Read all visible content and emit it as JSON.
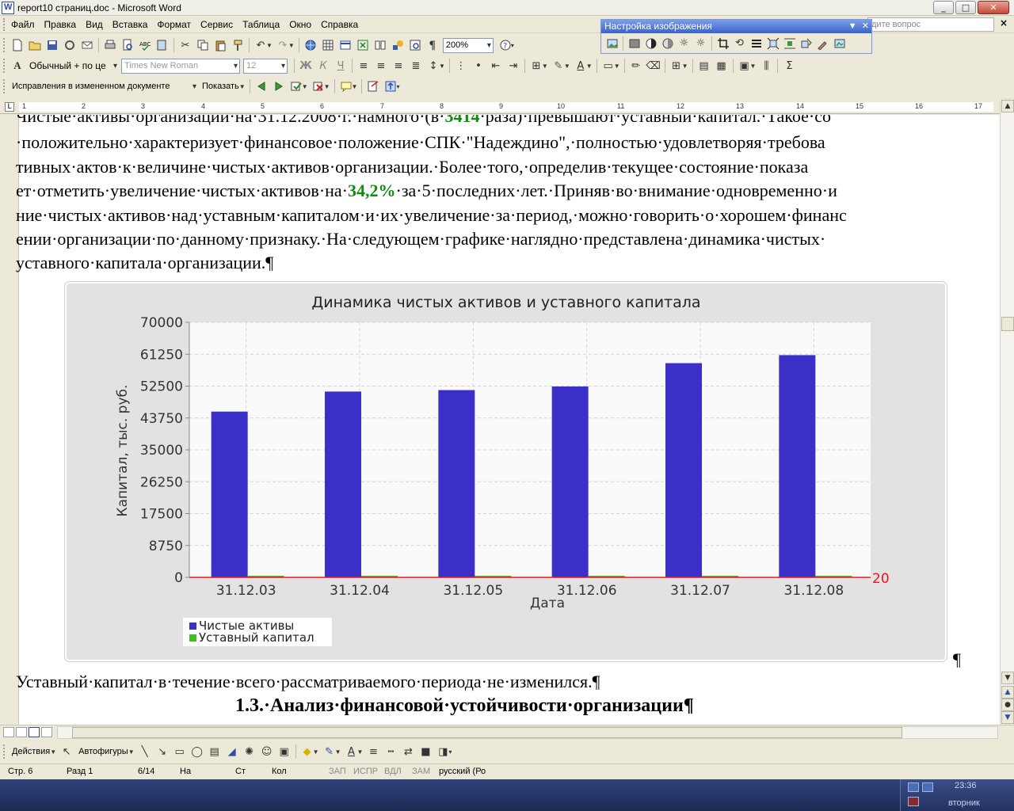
{
  "window": {
    "title": "report10 страниц.doc - Microsoft Word"
  },
  "menu": {
    "items": [
      "Файл",
      "Правка",
      "Вид",
      "Вставка",
      "Формат",
      "Сервис",
      "Таблица",
      "Окно",
      "Справка"
    ],
    "help_placeholder": "дите вопрос",
    "close_glyph": "×"
  },
  "picture_toolbar": {
    "title": "Настройка изображения"
  },
  "standard_toolbar": {
    "zoom": "200%"
  },
  "format_toolbar": {
    "style": "Обычный + по це",
    "font": "Times New Roman",
    "size": "12"
  },
  "review_toolbar": {
    "display_mode": "Исправления в измененном документе",
    "show_label": "Показать"
  },
  "ruler": {
    "corner": "L",
    "numbers": [
      "1",
      "1",
      "2",
      "3",
      "4",
      "5",
      "6",
      "7",
      "8",
      "9",
      "10",
      "11",
      "12",
      "13",
      "14",
      "15",
      "16",
      "17"
    ]
  },
  "document": {
    "lines": [
      {
        "pre": "Чистые·активы·организации·на·31.12.2008·г.·намного·(в·",
        "hl": "3414",
        "post": "·раза)·превышают·уставный·капитал.·Такое·со"
      },
      {
        "pre": "·положительно·характеризует·финансовое·положение·СПК·\"Надеждино\",·полностью·удовлетворяя·требова",
        "hl": "",
        "post": ""
      },
      {
        "pre": "тивных·актов·к·величине·чистых·активов·организации.·Более·того,·определив·текущее·состояние·показа",
        "hl": "",
        "post": ""
      },
      {
        "pre": "ет·отметить·увеличение·чистых·активов·на·",
        "hl": "34,2%",
        "post": "·за·5·последних·лет.·Приняв·во·внимание·одновременно·и"
      },
      {
        "pre": "ние·чистых·активов·над·уставным·капиталом·и·их·увеличение·за·период,·можно·говорить·о·хорошем·финанс",
        "hl": "",
        "post": ""
      },
      {
        "pre": "ении·организации·по·данному·признаку.·На·следующем·графике·наглядно·представлена·динамика·чистых·",
        "hl": "",
        "post": ""
      },
      {
        "pre": "уставного·капитала·организации.¶",
        "hl": "",
        "post": ""
      }
    ],
    "after_chart": "Уставный·капитал·в·течение·всего·рассматриваемого·периода·не·изменился.¶",
    "heading": "1.3.·Анализ·финансовой·устойчивости·организации¶",
    "pilcrow": "¶"
  },
  "chart_data": {
    "type": "bar",
    "title": "Динамика чистых активов и уставного капитала",
    "xlabel": "Дата",
    "ylabel": "Капитал, тыс. руб.",
    "categories": [
      "31.12.03",
      "31.12.04",
      "31.12.05",
      "31.12.06",
      "31.12.07",
      "31.12.08"
    ],
    "yticks": [
      "0",
      "8750",
      "17500",
      "26250",
      "35000",
      "43750",
      "52500",
      "61250",
      "70000"
    ],
    "ylim": [
      0,
      70000
    ],
    "series": [
      {
        "name": "Чистые активы",
        "color": "#3a30c8",
        "values": [
          45500,
          51000,
          51400,
          52400,
          58800,
          61000
        ]
      },
      {
        "name": "Уставный капитал",
        "color": "#3fbf1f",
        "values": [
          20,
          20,
          20,
          20,
          20,
          20
        ]
      }
    ],
    "reference_label": "20",
    "reference_color": "#e8191c",
    "grid": true,
    "legend_position": "bottom-left"
  },
  "drawing_toolbar": {
    "actions": "Действия",
    "autoshapes": "Автофигуры"
  },
  "status": {
    "page": "Стр. 6",
    "section": "Разд 1",
    "pages": "6/14",
    "at": "На",
    "line": "Ст",
    "col": "Кол",
    "rec": "ЗАП",
    "trk": "ИСПР",
    "ext": "ВДЛ",
    "ovr": "ЗАМ",
    "lang": "русский (Ро"
  },
  "taskbar": {
    "time": "23:36",
    "day": "вторник"
  }
}
